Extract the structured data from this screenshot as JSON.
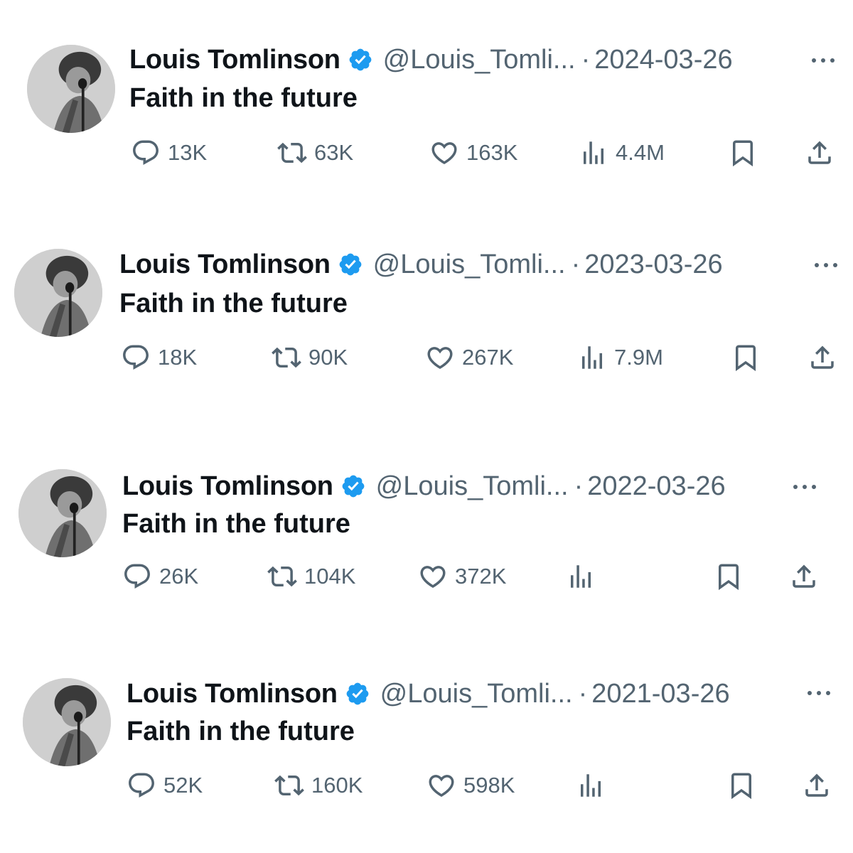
{
  "tweets": [
    {
      "name": "Louis Tomlinson",
      "handle": "@Louis_Tomli...",
      "separator": "·",
      "date": "2024-03-26",
      "text": "Faith in the future",
      "replies": "13K",
      "reposts": "63K",
      "likes": "163K",
      "views": "4.4M"
    },
    {
      "name": "Louis Tomlinson",
      "handle": "@Louis_Tomli...",
      "separator": "·",
      "date": "2023-03-26",
      "text": "Faith in the future",
      "replies": "18K",
      "reposts": "90K",
      "likes": "267K",
      "views": "7.9M"
    },
    {
      "name": "Louis Tomlinson",
      "handle": "@Louis_Tomli...",
      "separator": "·",
      "date": "2022-03-26",
      "text": "Faith in the future",
      "replies": "26K",
      "reposts": "104K",
      "likes": "372K",
      "views": ""
    },
    {
      "name": "Louis Tomlinson",
      "handle": "@Louis_Tomli...",
      "separator": "·",
      "date": "2021-03-26",
      "text": "Faith in the future",
      "replies": "52K",
      "reposts": "160K",
      "likes": "598K",
      "views": ""
    }
  ],
  "icons": {
    "verified": "verified-badge-icon",
    "more": "more-options-icon",
    "reply": "reply-icon",
    "repost": "repost-icon",
    "like": "like-icon",
    "views": "views-icon",
    "bookmark": "bookmark-icon",
    "share": "share-icon"
  },
  "colors": {
    "text": "#0f1419",
    "secondary": "#536471",
    "verified": "#1d9bf0"
  }
}
